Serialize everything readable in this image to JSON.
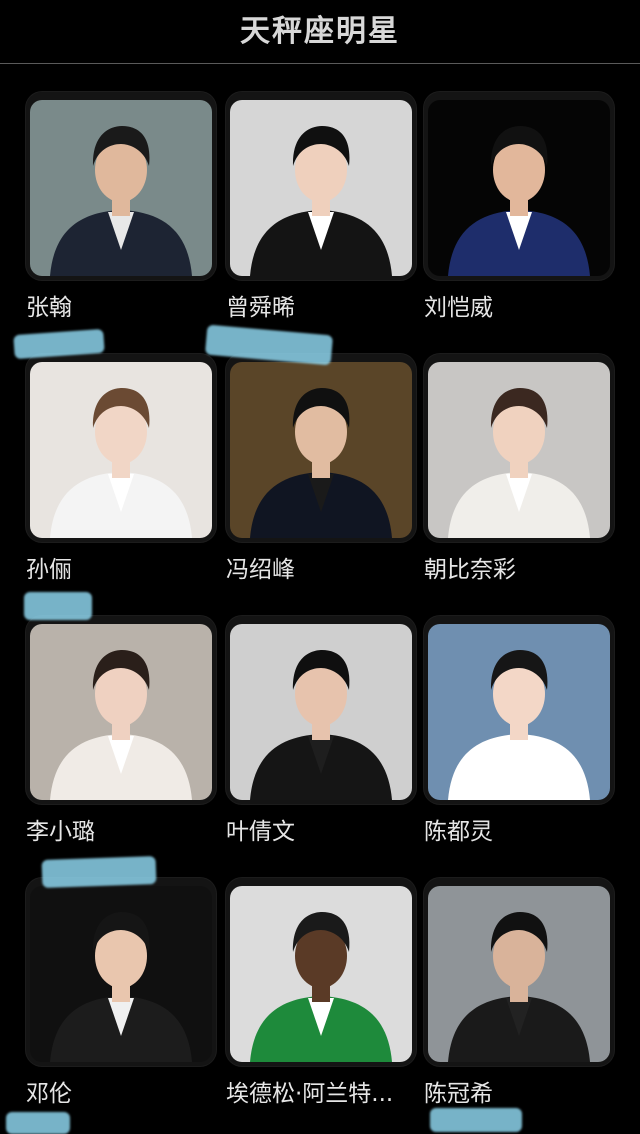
{
  "header": {
    "title": "天秤座明星"
  },
  "celebrities": [
    {
      "name": "张翰",
      "bg": "#7a8a8a",
      "suit": "#1d2433",
      "shirt": "#e8e8e8",
      "hair": "#1a1a1a",
      "skin": "#e0b89c"
    },
    {
      "name": "曾舜晞",
      "bg": "#d6d6d6",
      "suit": "#141414",
      "shirt": "#ffffff",
      "hair": "#101010",
      "skin": "#efd0bd"
    },
    {
      "name": "刘恺威",
      "bg": "#050505",
      "suit": "#1e2d6b",
      "shirt": "#ffffff",
      "hair": "#111111",
      "skin": "#e2b79b"
    },
    {
      "name": "孙俪",
      "bg": "#e8e4e0",
      "suit": "#f4f4f4",
      "shirt": "#ffffff",
      "hair": "#6b4a33",
      "skin": "#f1d6c6"
    },
    {
      "name": "冯绍峰",
      "bg": "#5a4528",
      "suit": "#101522",
      "shirt": "#1a1a1a",
      "hair": "#101010",
      "skin": "#e1bca1"
    },
    {
      "name": "朝比奈彩",
      "bg": "#c8c6c4",
      "suit": "#f0eeea",
      "shirt": "#ffffff",
      "hair": "#3b2820",
      "skin": "#f0d2bf"
    },
    {
      "name": "李小璐",
      "bg": "#b9b2aa",
      "suit": "#f0ebe6",
      "shirt": "#ffffff",
      "hair": "#2a1f1a",
      "skin": "#efd1c1"
    },
    {
      "name": "叶倩文",
      "bg": "#cfcfcf",
      "suit": "#151515",
      "shirt": "#1e1e1e",
      "hair": "#0f0f0f",
      "skin": "#e7c3ad"
    },
    {
      "name": "陈都灵",
      "bg": "#6f8fb0",
      "suit": "#ffffff",
      "shirt": "#ffffff",
      "hair": "#161616",
      "skin": "#f3d7c7"
    },
    {
      "name": "邓伦",
      "bg": "#101010",
      "suit": "#1c1c1c",
      "shirt": "#f0f0f0",
      "hair": "#151515",
      "skin": "#e9c6ae"
    },
    {
      "name": "埃德松·阿兰特...",
      "bg": "#dcdcdc",
      "suit": "#1e8a3b",
      "shirt": "#ffffff",
      "hair": "#1a1a1a",
      "skin": "#5a3a26"
    },
    {
      "name": "陈冠希",
      "bg": "#8f9498",
      "suit": "#1a1a1a",
      "shirt": "#222222",
      "hair": "#111111",
      "skin": "#d9b39a"
    }
  ]
}
